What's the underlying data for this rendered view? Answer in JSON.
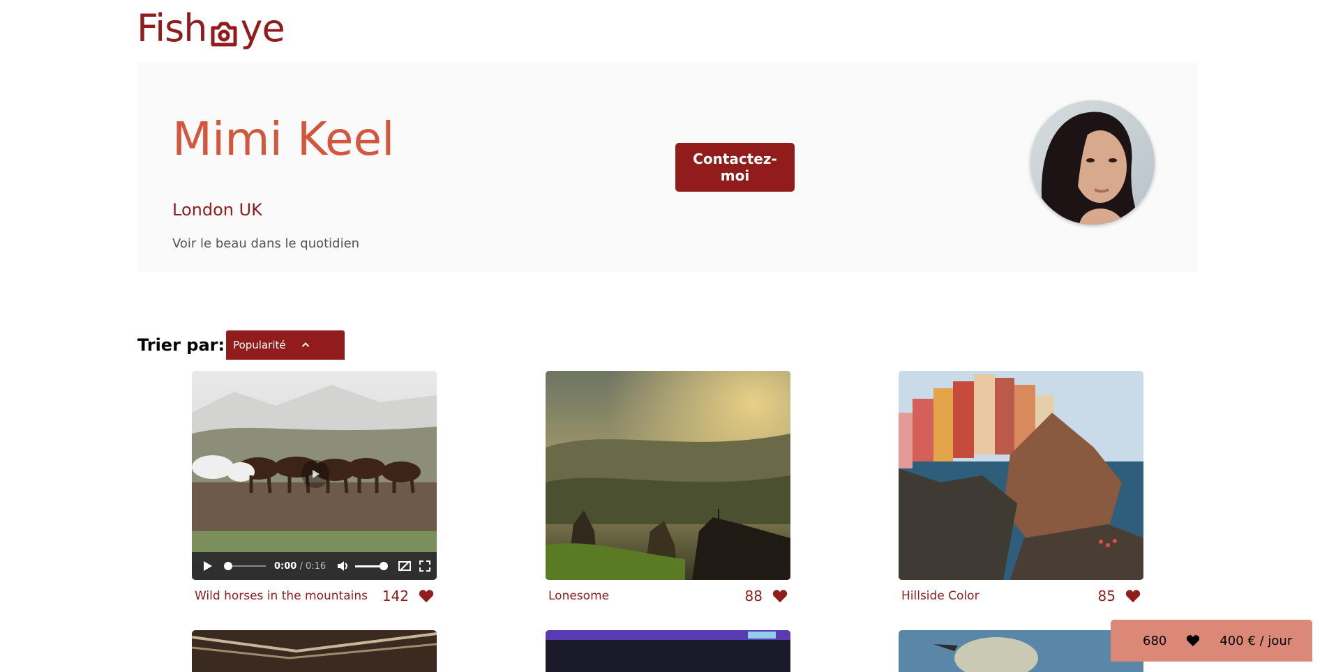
{
  "brand": {
    "logo_left": "Fish",
    "logo_right": "ye"
  },
  "photographer": {
    "name": "Mimi Keel",
    "location": "London UK",
    "tagline": "Voir le beau dans le quotidien",
    "contact_label": "Contactez-moi"
  },
  "sort": {
    "label": "Trier par:",
    "selected": "Popularité"
  },
  "media": [
    {
      "title": "Wild horses in the mountains",
      "likes": "142",
      "type": "video",
      "video": {
        "current_time": "0:00",
        "separator": " / ",
        "duration": "0:16"
      }
    },
    {
      "title": "Lonesome",
      "likes": "88",
      "type": "image"
    },
    {
      "title": "Hillside Color",
      "likes": "85",
      "type": "image"
    }
  ],
  "summary": {
    "total_likes": "680",
    "price": "400 € / jour"
  },
  "colors": {
    "primary": "#901C1C",
    "secondary": "#D3573C",
    "summary_bg": "#DB8876",
    "panel_bg": "#FAFAFA"
  }
}
